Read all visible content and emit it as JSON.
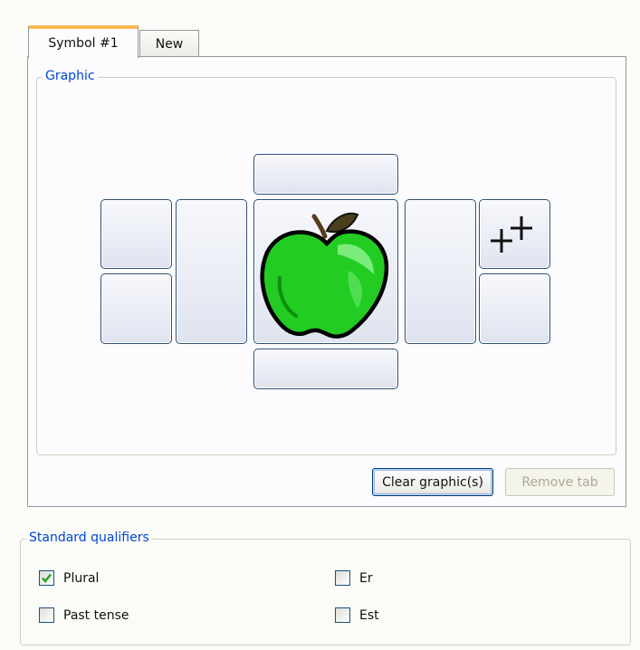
{
  "tabs": [
    {
      "label": "Symbol #1",
      "active": true
    },
    {
      "label": "New",
      "active": false
    }
  ],
  "graphic": {
    "legend": "Graphic",
    "center_icon": "green-apple",
    "plus_cell_icon": "plus-plus-icon",
    "clear_button": "Clear graphic(s)",
    "remove_button": "Remove tab"
  },
  "qualifiers": {
    "legend": "Standard qualifiers",
    "items": [
      {
        "label": "Plural",
        "checked": true
      },
      {
        "label": "Er",
        "checked": false
      },
      {
        "label": "Past tense",
        "checked": false
      },
      {
        "label": "Est",
        "checked": false
      }
    ]
  },
  "colors": {
    "accent_tab": "#f7b94e",
    "legend_text": "#0046d5",
    "check_mark": "#21a121",
    "apple": "#22cc22"
  }
}
